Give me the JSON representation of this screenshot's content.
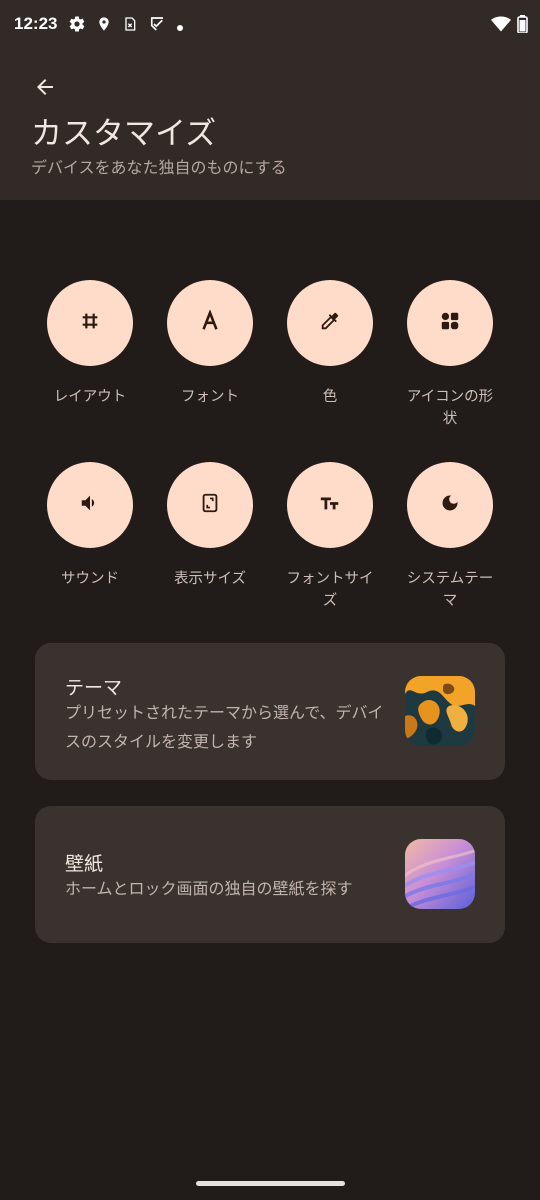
{
  "status_bar": {
    "time": "12:23",
    "left_icons": [
      "gear-icon",
      "location-pin-icon",
      "sim-card-icon",
      "shield-check-icon",
      "dot-icon"
    ],
    "right_icons": [
      "wifi-icon",
      "battery-icon"
    ]
  },
  "header": {
    "back_icon": "arrow-back-icon",
    "title": "カスタマイズ",
    "subtitle": "デバイスをあなた独自のものにする"
  },
  "grid": [
    {
      "label": "レイアウト",
      "icon": "grid-hash-icon"
    },
    {
      "label": "フォント",
      "icon": "font-a-icon"
    },
    {
      "label": "色",
      "icon": "eyedropper-icon"
    },
    {
      "label": "アイコンの形状",
      "icon": "icon-shapes-icon"
    },
    {
      "label": "サウンド",
      "icon": "speaker-icon"
    },
    {
      "label": "表示サイズ",
      "icon": "display-size-icon"
    },
    {
      "label": "フォントサイズ",
      "icon": "font-size-icon"
    },
    {
      "label": "システムテーマ",
      "icon": "moon-icon"
    }
  ],
  "cards": [
    {
      "title": "テーマ",
      "description": "プリセットされたテーマから選んで、デバイスのスタイルを変更します"
    },
    {
      "title": "壁紙",
      "description": "ホームとロック画面の独自の壁紙を探す"
    }
  ],
  "colors": {
    "background": "#211c19",
    "header": "#322a27",
    "circle": "#ffdbc9",
    "card": "#3a322e"
  }
}
